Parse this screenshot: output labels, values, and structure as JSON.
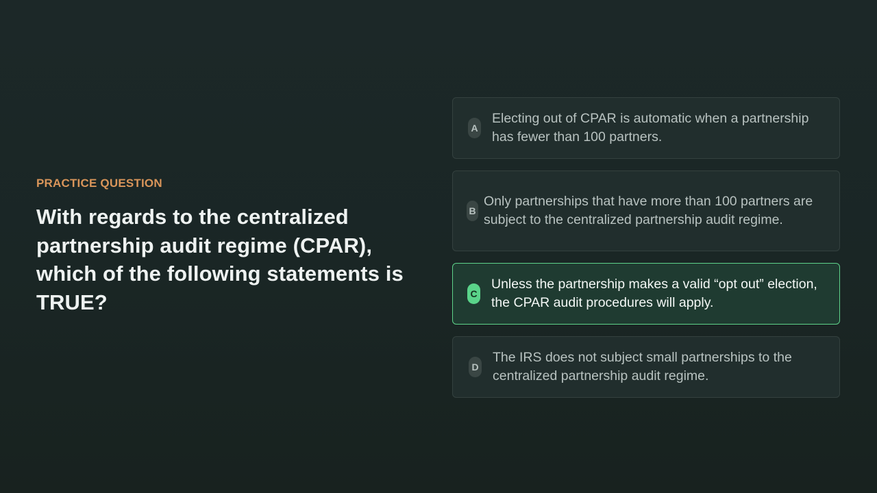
{
  "question_panel": {
    "eyebrow": "PRACTICE QUESTION",
    "question": "With regards to the centralized partnership audit regime (CPAR), which of the following statements is TRUE?"
  },
  "options": [
    {
      "letter": "A",
      "text": "Electing out of CPAR is automatic when a partnership has fewer than 100 partners.",
      "state": "default"
    },
    {
      "letter": "B",
      "text": "Only partnerships that have more than 100 partners are subject to the centralized partnership audit regime.",
      "state": "default"
    },
    {
      "letter": "C",
      "text": "Unless the partnership makes a valid “opt out” election, the CPAR audit procedures will apply.",
      "state": "correct"
    },
    {
      "letter": "D",
      "text": "The IRS does not subject small partnerships to the centralized partnership audit regime.",
      "state": "default"
    }
  ],
  "colors": {
    "background": "#1b2726",
    "eyebrow": "#d9955a",
    "correct_accent": "#5ed38a",
    "option_border": "#34413f"
  }
}
